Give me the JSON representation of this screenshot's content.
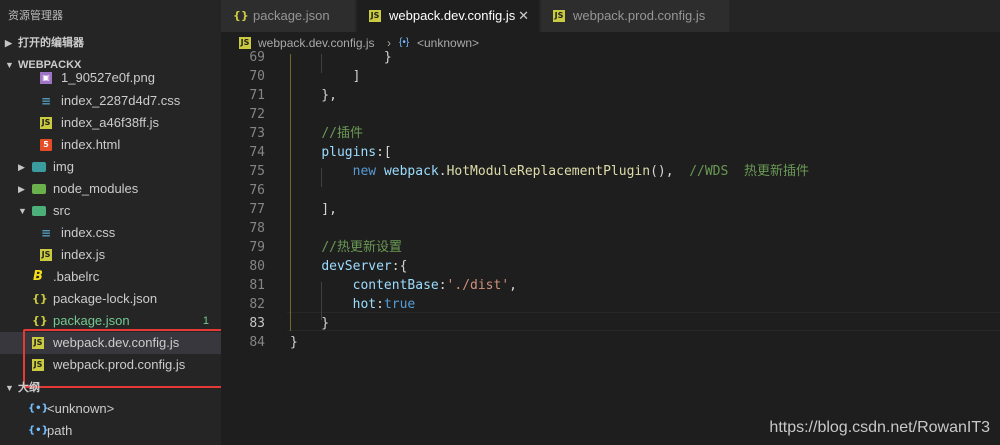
{
  "explorer": {
    "title": "资源管理器",
    "open_editors": "打开的编辑器",
    "project": "WEBPACKX",
    "outline": "大纲",
    "files": [
      {
        "name": "1_90527e0f.png",
        "icon": "image-file-icon"
      },
      {
        "name": "index_2287d4d7.css",
        "icon": "css-file-icon"
      },
      {
        "name": "index_a46f38ff.js",
        "icon": "js-file-icon"
      },
      {
        "name": "index.html",
        "icon": "html-file-icon"
      },
      {
        "name": "img",
        "icon": "folder-icon"
      },
      {
        "name": "node_modules",
        "icon": "folder-icon"
      },
      {
        "name": "src",
        "icon": "folder-open-icon"
      },
      {
        "name": "index.css",
        "icon": "css-file-icon"
      },
      {
        "name": "index.js",
        "icon": "js-file-icon"
      },
      {
        "name": ".babelrc",
        "icon": "babel-file-icon"
      },
      {
        "name": "package-lock.json",
        "icon": "json-file-icon"
      },
      {
        "name": "package.json",
        "icon": "json-file-icon",
        "badge": "1"
      },
      {
        "name": "webpack.dev.config.js",
        "icon": "js-file-icon"
      },
      {
        "name": "webpack.prod.config.js",
        "icon": "js-file-icon"
      }
    ],
    "outline_items": [
      "<unknown>",
      "path"
    ]
  },
  "tabs": [
    {
      "label": "package.json",
      "close": ""
    },
    {
      "label": "webpack.dev.config.js",
      "close": "✕"
    },
    {
      "label": "webpack.prod.config.js",
      "close": ""
    }
  ],
  "breadcrumb": {
    "file": "webpack.dev.config.js",
    "sep": "›",
    "symbol": "<unknown>"
  },
  "editor": {
    "line_numbers": [
      "69",
      "70",
      "71",
      "72",
      "73",
      "74",
      "75",
      "76",
      "77",
      "78",
      "79",
      "80",
      "81",
      "82",
      "83",
      "84"
    ],
    "lines": [
      {
        "t": "            }"
      },
      {
        "t": "        ]"
      },
      {
        "t": "    },"
      },
      {
        "t": ""
      },
      {
        "t": "    //插件"
      },
      {
        "t": "    plugins:["
      },
      {
        "t": "        new webpack.HotModuleReplacementPlugin(),  //WDS  热更新插件"
      },
      {
        "t": ""
      },
      {
        "t": "    ],"
      },
      {
        "t": ""
      },
      {
        "t": "    //热更新设置"
      },
      {
        "t": "    devServer:{"
      },
      {
        "t": "        contentBase:'./dist',"
      },
      {
        "t": "        hot:true"
      },
      {
        "t": "    }"
      },
      {
        "t": "}"
      }
    ]
  },
  "watermark": "https://blog.csdn.net/RowanIT3"
}
